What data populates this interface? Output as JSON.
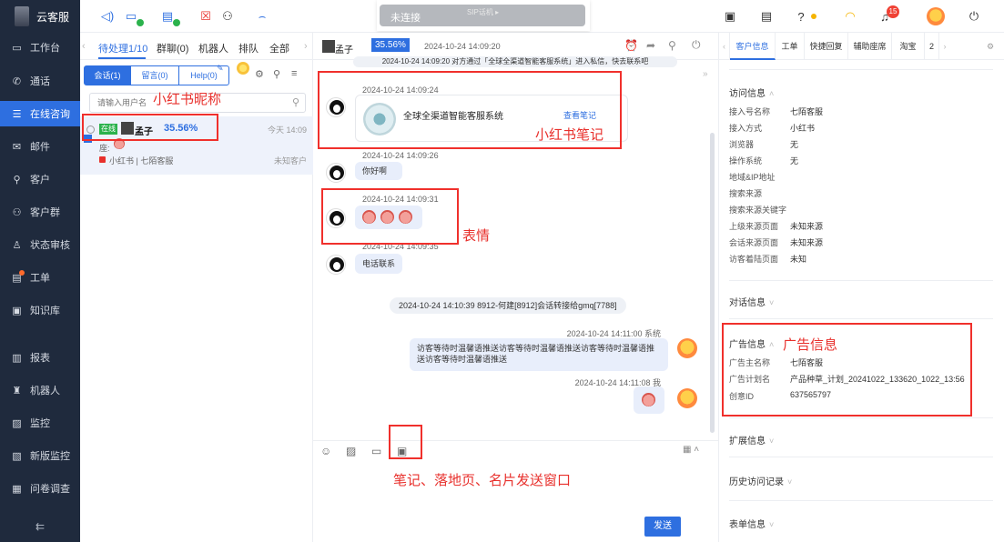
{
  "app": {
    "brand": "云客服"
  },
  "sidebar": {
    "items": [
      {
        "label": "工作台",
        "icon": "monitor-icon"
      },
      {
        "label": "通话",
        "icon": "phone-icon"
      },
      {
        "label": "在线咨询",
        "icon": "chat-icon"
      },
      {
        "label": "邮件",
        "icon": "mail-icon"
      },
      {
        "label": "客户",
        "icon": "user-icon"
      },
      {
        "label": "客户群",
        "icon": "group-icon"
      },
      {
        "label": "状态审核",
        "icon": "audit-icon"
      },
      {
        "label": "工单",
        "icon": "ticket-icon"
      },
      {
        "label": "知识库",
        "icon": "book-icon"
      },
      {
        "label": "报表",
        "icon": "bar-chart-icon"
      },
      {
        "label": "机器人",
        "icon": "robot-icon"
      },
      {
        "label": "监控",
        "icon": "monitor-screen-icon"
      },
      {
        "label": "新版监控",
        "icon": "new-monitor-icon"
      },
      {
        "label": "问卷调查",
        "icon": "survey-icon"
      }
    ],
    "collapse": "⇇"
  },
  "topbar": {
    "sip_status": "未连接",
    "sip_label": "SIP话机 ▸",
    "notification_count": "15"
  },
  "list": {
    "tabs": [
      "待处理1/10",
      "群聊(0)",
      "机器人",
      "排队",
      "全部"
    ],
    "segments": [
      "会话(1)",
      "留言(0)",
      "Help(0)"
    ],
    "search_placeholder": "请输入用户名",
    "session": {
      "status": "在线",
      "name": "孟子",
      "score": "35.56%",
      "time": "今天 14:09",
      "seat": "座: ",
      "source": "小红书 | 七陌客服",
      "tag": "未知客户"
    }
  },
  "chat": {
    "header_name": "孟子",
    "header_score": "35.56%",
    "header_time": "2024-10-24 14:09:20",
    "top_msg": "2024-10-24 14:09:20 对方通过「全球全渠道智能客服系统」进入私信，快去联系吧",
    "m1_time": "2024-10-24 14:09:24",
    "card_title": "全球全渠道智能客服系统",
    "card_link": "查看笔记",
    "m2_time": "2024-10-24 14:09:26",
    "m2_text": "你好啊",
    "m3_time": "2024-10-24 14:09:31",
    "m4_time": "2024-10-24 14:09:35",
    "m4_text": "电话联系",
    "transfer": "2024-10-24 14:10:39 8912-何建[8912]会话转接给gmq[7788]",
    "m5_time": "2024-10-24 14:11:00 系统",
    "m5_text": "访客等待时温馨语推送访客等待时温馨语推送访客等待时温馨语推送访客等待时温馨语推送",
    "m6_time": "2024-10-24 14:11:08 我",
    "send": "发送",
    "expand": "»"
  },
  "right": {
    "tabs": [
      "客户信息",
      "工单",
      "快捷回复",
      "辅助座席",
      "淘宝",
      "2"
    ],
    "visit_title": "访问信息",
    "visit": [
      {
        "k": "接入号名称",
        "v": "七陌客服"
      },
      {
        "k": "接入方式",
        "v": "小红书"
      },
      {
        "k": "浏览器",
        "v": "无"
      },
      {
        "k": "操作系统",
        "v": "无"
      },
      {
        "k": "地域&IP地址",
        "v": ""
      },
      {
        "k": "搜索来源",
        "v": ""
      },
      {
        "k": "搜索来源关键字",
        "v": ""
      },
      {
        "k": "上级来源页面",
        "v": "未知来源"
      },
      {
        "k": "会话来源页面",
        "v": "未知来源"
      },
      {
        "k": "访客着陆页面",
        "v": "未知"
      }
    ],
    "dialog_title": "对话信息",
    "ad_title": "广告信息",
    "ad": [
      {
        "k": "广告主名称",
        "v": "七陌客服"
      },
      {
        "k": "广告计划名",
        "v": "产品种草_计划_20241022_133620_1022_13:56"
      },
      {
        "k": "创意ID",
        "v": "637565797"
      }
    ],
    "ext_title": "扩展信息",
    "history_title": "历史访问记录",
    "form_title": "表单信息"
  },
  "annotations": {
    "nickname": "小红书昵称",
    "note": "小红书笔记",
    "emoji": "表情",
    "ad": "广告信息",
    "window": "笔记、落地页、名片发送窗口"
  }
}
